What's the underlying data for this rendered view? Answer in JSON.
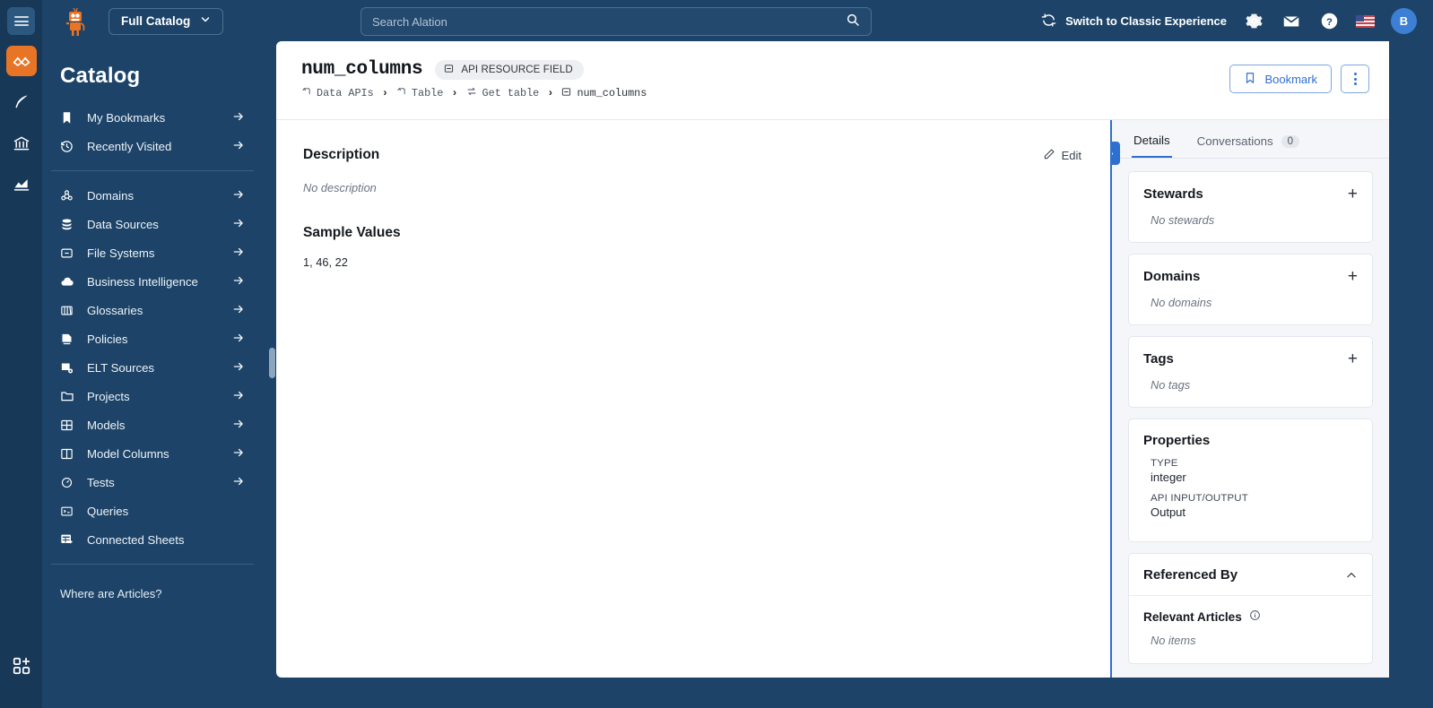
{
  "topbar": {
    "hamburger_icon": "hamburger-menu-icon",
    "logo": "alation-robot-logo",
    "catalog_selector": {
      "label": "Full Catalog",
      "chevron": "chevron-down-icon"
    },
    "search": {
      "placeholder": "Search Alation",
      "value": "",
      "icon": "search-icon"
    },
    "switch_experience": {
      "label": "Switch to Classic Experience",
      "icon": "refresh-swap-icon"
    },
    "settings_icon": "gear-icon",
    "mail_icon": "envelope-icon",
    "help_icon": "question-circle-icon",
    "locale_icon": "us-flag-icon",
    "avatar_initial": "B"
  },
  "rail": {
    "items": [
      {
        "name": "analytics-active-icon",
        "active": true
      },
      {
        "name": "pen-feather-icon",
        "active": false
      },
      {
        "name": "bank-governance-icon",
        "active": false
      },
      {
        "name": "chart-insights-icon",
        "active": false
      }
    ],
    "bottom_item": {
      "name": "add-app-icon"
    }
  },
  "sidebar": {
    "title": "Catalog",
    "group1": [
      {
        "label": "My Bookmarks",
        "icon": "bookmark-icon",
        "arrow": true
      },
      {
        "label": "Recently Visited",
        "icon": "history-clock-icon",
        "arrow": true
      }
    ],
    "group2": [
      {
        "label": "Domains",
        "icon": "domains-icon",
        "arrow": true
      },
      {
        "label": "Data Sources",
        "icon": "database-icon",
        "arrow": true
      },
      {
        "label": "File Systems",
        "icon": "file-system-icon",
        "arrow": true
      },
      {
        "label": "Business Intelligence",
        "icon": "cloud-icon",
        "arrow": true
      },
      {
        "label": "Glossaries",
        "icon": "books-icon",
        "arrow": true
      },
      {
        "label": "Policies",
        "icon": "policy-icon",
        "arrow": true
      },
      {
        "label": "ELT Sources",
        "icon": "elt-icon",
        "arrow": true
      },
      {
        "label": "Projects",
        "icon": "folder-icon",
        "arrow": true
      },
      {
        "label": "Models",
        "icon": "grid-table-icon",
        "arrow": true
      },
      {
        "label": "Model Columns",
        "icon": "columns-icon",
        "arrow": true
      },
      {
        "label": "Tests",
        "icon": "gauge-icon",
        "arrow": true
      },
      {
        "label": "Queries",
        "icon": "query-icon",
        "arrow": false
      },
      {
        "label": "Connected Sheets",
        "icon": "sheets-icon",
        "arrow": false
      }
    ],
    "footer_link": "Where are Articles?"
  },
  "page": {
    "title": "num_columns",
    "type_badge": {
      "label": "API RESOURCE FIELD",
      "icon": "field-icon"
    },
    "breadcrumb": [
      {
        "label": "Data APIs",
        "icon": "api-icon"
      },
      {
        "label": "Table",
        "icon": "api-icon"
      },
      {
        "label": "Get table",
        "icon": "endpoint-icon"
      },
      {
        "label": "num_columns",
        "icon": "field-icon"
      }
    ],
    "breadcrumb_separator": "›",
    "actions": {
      "bookmark_label": "Bookmark",
      "bookmark_icon": "bookmark-outline-icon",
      "kebab_icon": "more-vertical-icon"
    }
  },
  "content": {
    "description": {
      "heading": "Description",
      "edit_label": "Edit",
      "edit_icon": "pencil-icon",
      "empty_text": "No description"
    },
    "sample_values": {
      "heading": "Sample Values",
      "value": "1, 46, 22"
    }
  },
  "right_panel": {
    "toggle_icon": "chevron-right-icon",
    "tabs": [
      {
        "label": "Details",
        "count": null,
        "active": true
      },
      {
        "label": "Conversations",
        "count": "0",
        "active": false
      }
    ],
    "cards": [
      {
        "title": "Stewards",
        "action": "plus-icon",
        "empty": "No stewards"
      },
      {
        "title": "Domains",
        "action": "plus-icon",
        "empty": "No domains"
      },
      {
        "title": "Tags",
        "action": "plus-icon",
        "empty": "No tags"
      }
    ],
    "properties": {
      "title": "Properties",
      "rows": [
        {
          "key": "TYPE",
          "value": "integer"
        },
        {
          "key": "API INPUT/OUTPUT",
          "value": "Output"
        }
      ]
    },
    "referenced_by": {
      "title": "Referenced By",
      "collapse_icon": "chevron-up-icon",
      "sub_title": "Relevant Articles",
      "sub_info_icon": "info-circle-icon",
      "empty": "No items"
    }
  },
  "colors": {
    "nav_blue": "#1d4468",
    "rail_blue": "#183858",
    "accent_blue": "#2f6fd0",
    "orange": "#e87425",
    "panel_bg": "#f4f6f9"
  }
}
